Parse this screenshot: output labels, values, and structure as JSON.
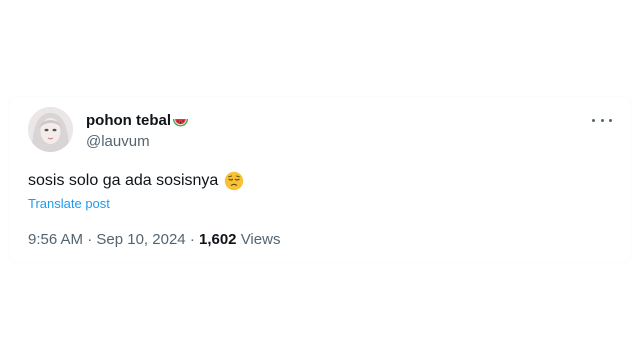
{
  "tweet": {
    "display_name": "pohon tebal",
    "handle": "@lauvum",
    "text": "sosis solo ga ada sosisnya",
    "translate_label": "Translate post",
    "time": "9:56 AM",
    "separator": "·",
    "date": "Sep 10, 2024",
    "views_count": "1,602",
    "views_label": "Views",
    "icons": {
      "name_emoji": "watermelon-icon",
      "text_emoji": "pensive-face-icon",
      "more": "more-options-icon"
    },
    "colors": {
      "text": "#0f1419",
      "secondary": "#536471",
      "link": "#1d9bf0"
    }
  }
}
